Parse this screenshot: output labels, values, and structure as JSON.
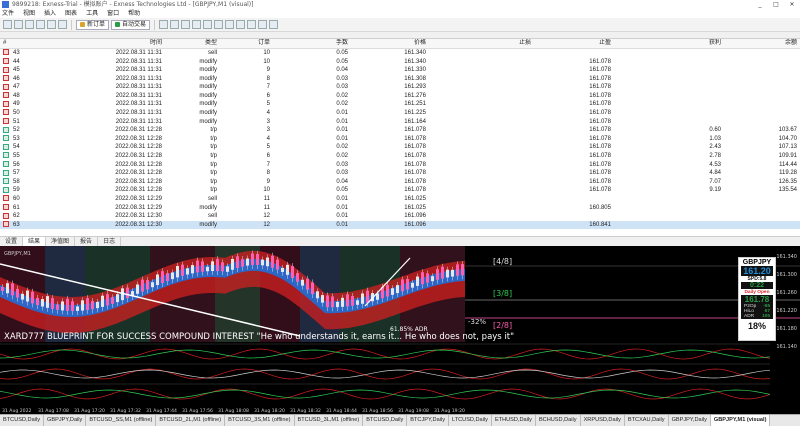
{
  "window": {
    "title": "9899218: Exness-Trial - 模拟账户 - Exness Technologies Ltd - [GBPJPY,M1 (visual)]",
    "buttons": [
      "_",
      "□",
      "✕"
    ]
  },
  "menu": [
    "文件",
    "视图",
    "插入",
    "图表",
    "工具",
    "窗口",
    "帮助"
  ],
  "toolbar": {
    "new_order": "新订单",
    "auto_trade": "自动交易"
  },
  "table": {
    "headers": [
      "#",
      "时间",
      "类型",
      "订单",
      "手数",
      "价格",
      "止损",
      "止盈",
      "获利",
      "余额"
    ],
    "rows": [
      [
        "43",
        "2022.08.31 11:31",
        "sell",
        "10",
        "0.05",
        "161.340",
        "",
        "",
        "",
        ""
      ],
      [
        "44",
        "2022.08.31 11:31",
        "modify",
        "10",
        "0.05",
        "161.340",
        "",
        "161.078",
        "",
        ""
      ],
      [
        "45",
        "2022.08.31 11:31",
        "modify",
        "9",
        "0.04",
        "161.330",
        "",
        "161.078",
        "",
        ""
      ],
      [
        "46",
        "2022.08.31 11:31",
        "modify",
        "8",
        "0.03",
        "161.308",
        "",
        "161.078",
        "",
        ""
      ],
      [
        "47",
        "2022.08.31 11:31",
        "modify",
        "7",
        "0.03",
        "161.293",
        "",
        "161.078",
        "",
        ""
      ],
      [
        "48",
        "2022.08.31 11:31",
        "modify",
        "6",
        "0.02",
        "161.276",
        "",
        "161.078",
        "",
        ""
      ],
      [
        "49",
        "2022.08.31 11:31",
        "modify",
        "5",
        "0.02",
        "161.251",
        "",
        "161.078",
        "",
        ""
      ],
      [
        "50",
        "2022.08.31 11:31",
        "modify",
        "4",
        "0.01",
        "161.225",
        "",
        "161.078",
        "",
        ""
      ],
      [
        "51",
        "2022.08.31 11:31",
        "modify",
        "3",
        "0.01",
        "161.164",
        "",
        "161.078",
        "",
        ""
      ],
      [
        "52",
        "2022.08.31 12:28",
        "t/p",
        "3",
        "0.01",
        "161.078",
        "",
        "161.078",
        "0.60",
        "103.67"
      ],
      [
        "53",
        "2022.08.31 12:28",
        "t/p",
        "4",
        "0.01",
        "161.078",
        "",
        "161.078",
        "1.03",
        "104.70"
      ],
      [
        "54",
        "2022.08.31 12:28",
        "t/p",
        "5",
        "0.02",
        "161.078",
        "",
        "161.078",
        "2.43",
        "107.13"
      ],
      [
        "55",
        "2022.08.31 12:28",
        "t/p",
        "6",
        "0.02",
        "161.078",
        "",
        "161.078",
        "2.78",
        "109.91"
      ],
      [
        "56",
        "2022.08.31 12:28",
        "t/p",
        "7",
        "0.03",
        "161.078",
        "",
        "161.078",
        "4.53",
        "114.44"
      ],
      [
        "57",
        "2022.08.31 12:28",
        "t/p",
        "8",
        "0.03",
        "161.078",
        "",
        "161.078",
        "4.84",
        "119.28"
      ],
      [
        "58",
        "2022.08.31 12:28",
        "t/p",
        "9",
        "0.04",
        "161.078",
        "",
        "161.078",
        "7.07",
        "126.35"
      ],
      [
        "59",
        "2022.08.31 12:28",
        "t/p",
        "10",
        "0.05",
        "161.078",
        "",
        "161.078",
        "9.19",
        "135.54"
      ],
      [
        "60",
        "2022.08.31 12:29",
        "sell",
        "11",
        "0.01",
        "161.025",
        "",
        "",
        "",
        ""
      ],
      [
        "61",
        "2022.08.31 12:29",
        "modify",
        "11",
        "0.01",
        "161.025",
        "",
        "160.805",
        "",
        ""
      ],
      [
        "62",
        "2022.08.31 12:30",
        "sell",
        "12",
        "0.01",
        "161.096",
        "",
        "",
        "",
        ""
      ],
      [
        "63",
        "2022.08.31 12:30",
        "modify",
        "12",
        "0.01",
        "161.096",
        "",
        "160.841",
        "",
        ""
      ]
    ]
  },
  "tabs": [
    "设置",
    "结果",
    "净值图",
    "报告",
    "日志"
  ],
  "chart": {
    "symbol_label": "GBPJPY,M1",
    "levels": [
      "[4/8]",
      "[3/8]",
      "[2/8]"
    ],
    "pct_label": "-32%",
    "headline": "XARD777 BLUEPRINT FOR SUCCESS  COMPOUND INTEREST  \"He who understands it, earns it... He who does not, pays it\"",
    "adr": "61.85% ADR",
    "price_labels": [
      "161.340",
      "161.300",
      "161.260",
      "161.220",
      "161.180",
      "161.140"
    ],
    "time_labels": [
      "31 Aug 2022",
      "31 Aug 17:08",
      "31 Aug 17:20",
      "31 Aug 17:32",
      "31 Aug 17:44",
      "31 Aug 17:56",
      "31 Aug 18:08",
      "31 Aug 18:20",
      "31 Aug 18:32",
      "31 Aug 18:44",
      "31 Aug 18:56",
      "31 Aug 19:08",
      "31 Aug 19:20"
    ],
    "colors": {
      "up": "#2a9d46",
      "down": "#d22020",
      "band_blue": "#1f6fd8",
      "bg": "#000000"
    }
  },
  "info_box": {
    "symbol": "GBPJPY",
    "price": "161.20",
    "spread": "SPD:5.8",
    "timer": "0:22",
    "daily_open_label": "Daily Open",
    "daily_open": "161.78",
    "rows": [
      [
        "P2Op",
        "-55"
      ],
      [
        "HiLo",
        "67"
      ],
      [
        "ADR",
        "105"
      ]
    ],
    "pct": "18%"
  },
  "bottom_tabs": [
    "BTCUSD,Daily",
    "GBPJPY,Daily",
    "BTCUSD_SS,M1 (offline)",
    "BTCUSD_2L,M1 (offline)",
    "BTCUSD_3S,M1 (offline)",
    "BTCUSD_3L,M1 (offline)",
    "BTCUSD,Daily",
    "BTCJPY,Daily",
    "LTCUSD,Daily",
    "ETHUSD,Daily",
    "BCHUSD,Daily",
    "XRPUSD,Daily",
    "BTCXAU,Daily",
    "GBPJPY,Daily",
    "GBPJPY,M1 (visual)"
  ],
  "bottom_active": "GBPJPY,M1 (visual)"
}
